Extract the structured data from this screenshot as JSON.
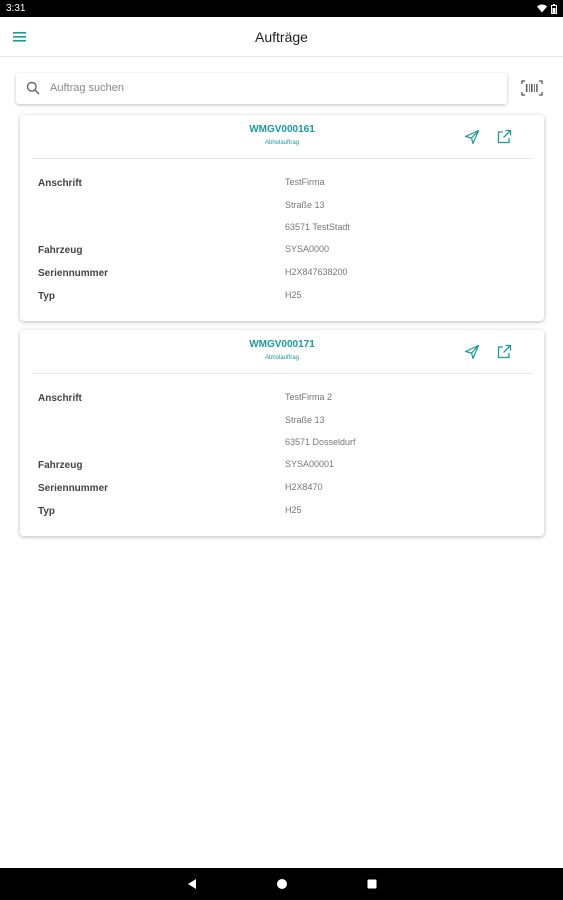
{
  "status_bar": {
    "time": "3:31"
  },
  "app_bar": {
    "title": "Aufträge"
  },
  "search": {
    "placeholder": "Auftrag suchen"
  },
  "colors": {
    "accent": "#1a9aa0"
  },
  "orders": [
    {
      "id": "WMGV000161",
      "type": "Abholauftrag",
      "labels": {
        "address": "Anschrift",
        "vehicle": "Fahrzeug",
        "serial": "Seriennummer",
        "type": "Typ"
      },
      "address": [
        "TestFirma",
        "Straße 13",
        "63571 TestStadt"
      ],
      "vehicle": "SYSA0000",
      "serial": "H2X847638200",
      "model": "H25"
    },
    {
      "id": "WMGV000171",
      "type": "Abholauftrag",
      "labels": {
        "address": "Anschrift",
        "vehicle": "Fahrzeug",
        "serial": "Seriennummer",
        "type": "Typ"
      },
      "address": [
        "TestFirma 2",
        "Straße 13",
        "63571 Dosseldurf"
      ],
      "vehicle": "SYSA00001",
      "serial": "H2X8470",
      "model": "H25"
    }
  ]
}
